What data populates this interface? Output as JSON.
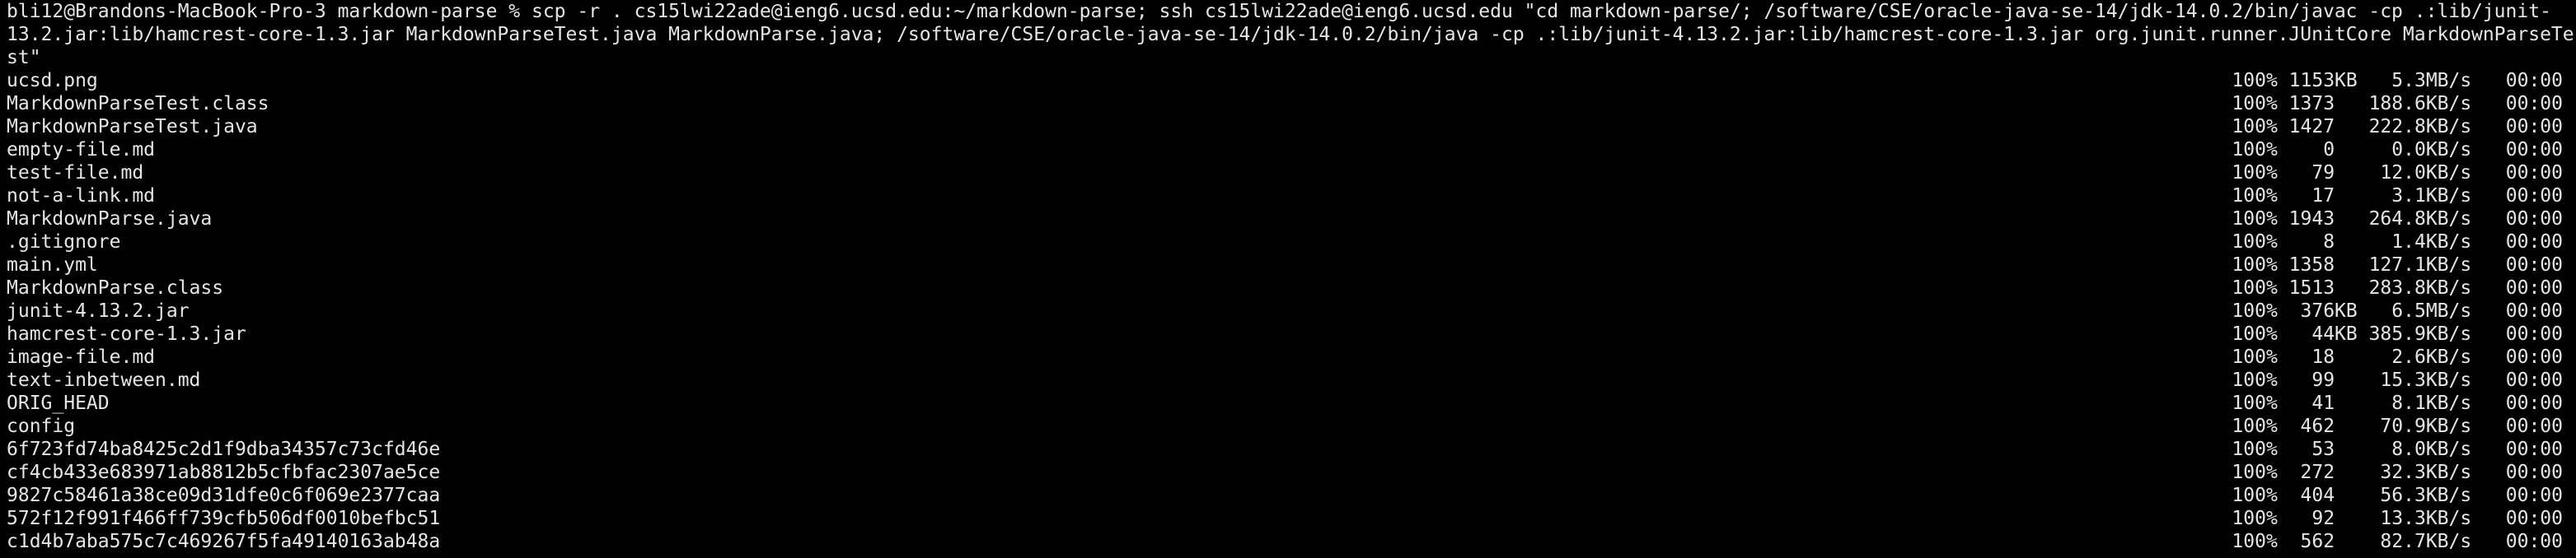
{
  "terminal": {
    "command_lines": [
      "bli12@Brandons-MacBook-Pro-3 markdown-parse % scp -r . cs15lwi22ade@ieng6.ucsd.edu:~/markdown-parse; ssh cs15lwi22ade@ieng6.ucsd.edu \"cd markdown-parse/; /software/CSE/oracle-java-se-14/jdk-14.0.2/bin/javac -cp .:lib/junit-",
      "13.2.jar:lib/hamcrest-core-1.3.jar MarkdownParseTest.java MarkdownParse.java; /software/CSE/oracle-java-se-14/jdk-14.0.2/bin/java -cp .:lib/junit-4.13.2.jar:lib/hamcrest-core-1.3.jar org.junit.runner.JUnitCore MarkdownParseTe",
      "st\""
    ],
    "transfers": [
      {
        "file": "ucsd.png",
        "stats": "100% 1153KB   5.3MB/s   00:00"
      },
      {
        "file": "MarkdownParseTest.class",
        "stats": "100% 1373   188.6KB/s   00:00"
      },
      {
        "file": "MarkdownParseTest.java",
        "stats": "100% 1427   222.8KB/s   00:00"
      },
      {
        "file": "empty-file.md",
        "stats": "100%    0     0.0KB/s   00:00"
      },
      {
        "file": "test-file.md",
        "stats": "100%   79    12.0KB/s   00:00"
      },
      {
        "file": "not-a-link.md",
        "stats": "100%   17     3.1KB/s   00:00"
      },
      {
        "file": "MarkdownParse.java",
        "stats": "100% 1943   264.8KB/s   00:00"
      },
      {
        "file": ".gitignore",
        "stats": "100%    8     1.4KB/s   00:00"
      },
      {
        "file": "main.yml",
        "stats": "100% 1358   127.1KB/s   00:00"
      },
      {
        "file": "MarkdownParse.class",
        "stats": "100% 1513   283.8KB/s   00:00"
      },
      {
        "file": "junit-4.13.2.jar",
        "stats": "100%  376KB   6.5MB/s   00:00"
      },
      {
        "file": "hamcrest-core-1.3.jar",
        "stats": "100%   44KB 385.9KB/s   00:00"
      },
      {
        "file": "image-file.md",
        "stats": "100%   18     2.6KB/s   00:00"
      },
      {
        "file": "text-inbetween.md",
        "stats": "100%   99    15.3KB/s   00:00"
      },
      {
        "file": "ORIG_HEAD",
        "stats": "100%   41     8.1KB/s   00:00"
      },
      {
        "file": "config",
        "stats": "100%  462    70.9KB/s   00:00"
      },
      {
        "file": "6f723fd74ba8425c2d1f9dba34357c73cfd46e",
        "stats": "100%   53     8.0KB/s   00:00"
      },
      {
        "file": "cf4cb433e683971ab8812b5cfbfac2307ae5ce",
        "stats": "100%  272    32.3KB/s   00:00"
      },
      {
        "file": "9827c58461a38ce09d31dfe0c6f069e2377caa",
        "stats": "100%  404    56.3KB/s   00:00"
      },
      {
        "file": "572f12f991f466ff739cfb506df0010befbc51",
        "stats": "100%   92    13.3KB/s   00:00"
      },
      {
        "file": "c1d4b7aba575c7c469267f5fa49140163ab48a",
        "stats": "100%  562    82.7KB/s   00:00"
      }
    ]
  }
}
